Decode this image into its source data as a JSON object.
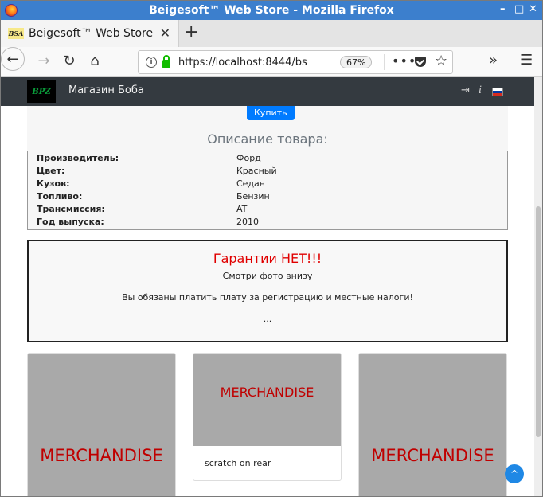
{
  "window": {
    "title": "Beigesoft™ Web Store - Mozilla Firefox"
  },
  "tab": {
    "favicon_text": "BSA",
    "title": "Beigesoft™ Web Store"
  },
  "nav": {
    "url_host": "https://localhost:8444/bs",
    "url_fade": "...",
    "zoom": "67%"
  },
  "site": {
    "logo_text": "BPZ",
    "brand": "Магазин Боба",
    "flag_colors": [
      "#ffffff",
      "#0039a6",
      "#d52b1e"
    ]
  },
  "product": {
    "buy_label": "Купить",
    "desc_title": "Описание товара:",
    "specs": [
      {
        "key": "Производитель:",
        "value": "Форд"
      },
      {
        "key": "Цвет:",
        "value": "Красный"
      },
      {
        "key": "Кузов:",
        "value": "Седан"
      },
      {
        "key": "Топливо:",
        "value": "Бензин"
      },
      {
        "key": "Трансмиссия:",
        "value": "AT"
      },
      {
        "key": "Год выпуска:",
        "value": "2010"
      }
    ]
  },
  "notice": {
    "heading": "Гарантии НЕТ!!!",
    "line1": "Смотри фото внизу",
    "line2": "Вы обязаны платить плату за регистрацию и местные налоги!",
    "line3": "..."
  },
  "cards": [
    {
      "label": "MERCHANDISE"
    },
    {
      "label": "MERCHANDISE",
      "caption": "scratch on rear"
    },
    {
      "label": "MERCHANDISE"
    }
  ],
  "colors": {
    "accent": "#007bff",
    "warning": "#e00000",
    "titlebar": "#3c7fcd"
  }
}
